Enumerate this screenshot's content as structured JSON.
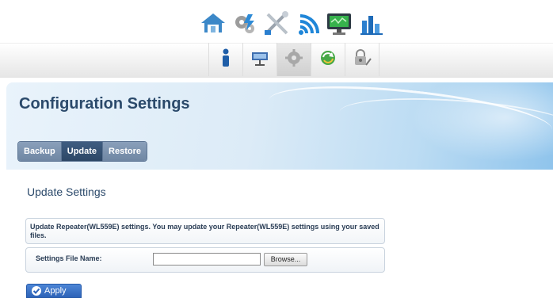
{
  "topnav": {
    "icons": [
      "house-icon",
      "gear-network-icon",
      "tools-icon",
      "wireless-icon",
      "monitor-icon",
      "statistics-icon"
    ]
  },
  "subnav": {
    "tabs": [
      "info-icon",
      "network-icon",
      "configuration-gear-icon",
      "refresh-arrows-icon",
      "lock-tools-icon"
    ],
    "active_index": 2
  },
  "header": {
    "title": "Configuration Settings"
  },
  "tabs": {
    "backup": "Backup",
    "update": "Update",
    "restore": "Restore",
    "active": "Update"
  },
  "section": {
    "title": "Update Settings"
  },
  "info": {
    "text": "Update Repeater(WL559E) settings. You may update your Repeater(WL559E) settings using your saved files."
  },
  "form": {
    "file_label": "Settings File Name:",
    "file_value": "",
    "browse_label": "Browse..."
  },
  "apply": {
    "label": "Apply"
  },
  "colors": {
    "title": "#2b4a6b",
    "tab_active": "#2d4766",
    "apply": "#2d63b8"
  }
}
